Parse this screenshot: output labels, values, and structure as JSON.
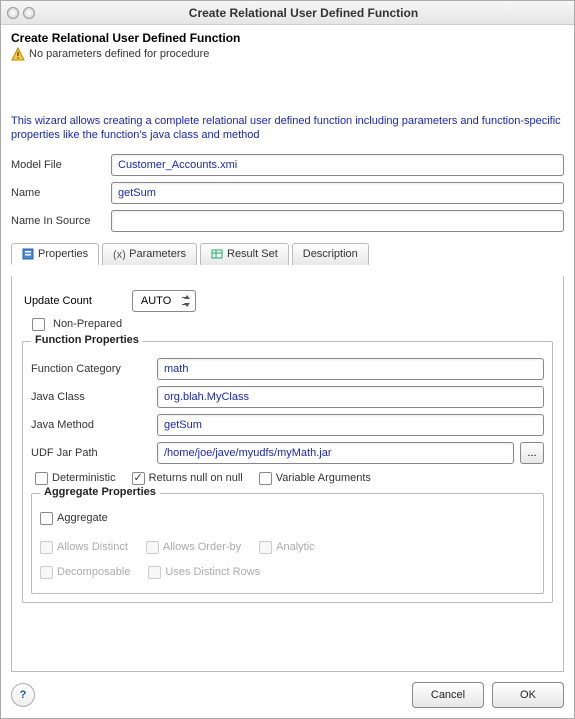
{
  "window": {
    "title": "Create Relational User Defined Function"
  },
  "header": {
    "title": "Create Relational User Defined Function",
    "warning": "No parameters defined for procedure"
  },
  "wizard_text": "This wizard allows creating a complete relational user defined function including parameters and function-specific properties like the function's java class and method",
  "fields": {
    "model_file_label": "Model File",
    "model_file_value": "Customer_Accounts.xmi",
    "name_label": "Name",
    "name_value": "getSum",
    "name_in_source_label": "Name In Source",
    "name_in_source_value": ""
  },
  "tabs": {
    "properties": "Properties",
    "parameters": "Parameters",
    "result_set": "Result Set",
    "description": "Description"
  },
  "properties": {
    "update_count_label": "Update Count",
    "update_count_value": "AUTO",
    "non_prepared_label": "Non-Prepared",
    "non_prepared_checked": false,
    "function_group_title": "Function Properties",
    "function_category_label": "Function Category",
    "function_category_value": "math",
    "java_class_label": "Java Class",
    "java_class_value": "org.blah.MyClass",
    "java_method_label": "Java Method",
    "java_method_value": "getSum",
    "udf_jar_path_label": "UDF Jar Path",
    "udf_jar_path_value": "/home/joe/jave/myudfs/myMath.jar",
    "browse_button": "...",
    "deterministic_label": "Deterministic",
    "deterministic_checked": false,
    "returns_null_label": "Returns null on null",
    "returns_null_checked": true,
    "variable_args_label": "Variable Arguments",
    "variable_args_checked": false,
    "aggregate_group_title": "Aggregate Properties",
    "aggregate_label": "Aggregate",
    "aggregate_checked": false,
    "allows_distinct_label": "Allows Distinct",
    "allows_orderby_label": "Allows Order-by",
    "analytic_label": "Analytic",
    "decomposable_label": "Decomposable",
    "uses_distinct_rows_label": "Uses Distinct Rows"
  },
  "footer": {
    "help": "?",
    "cancel": "Cancel",
    "ok": "OK"
  }
}
